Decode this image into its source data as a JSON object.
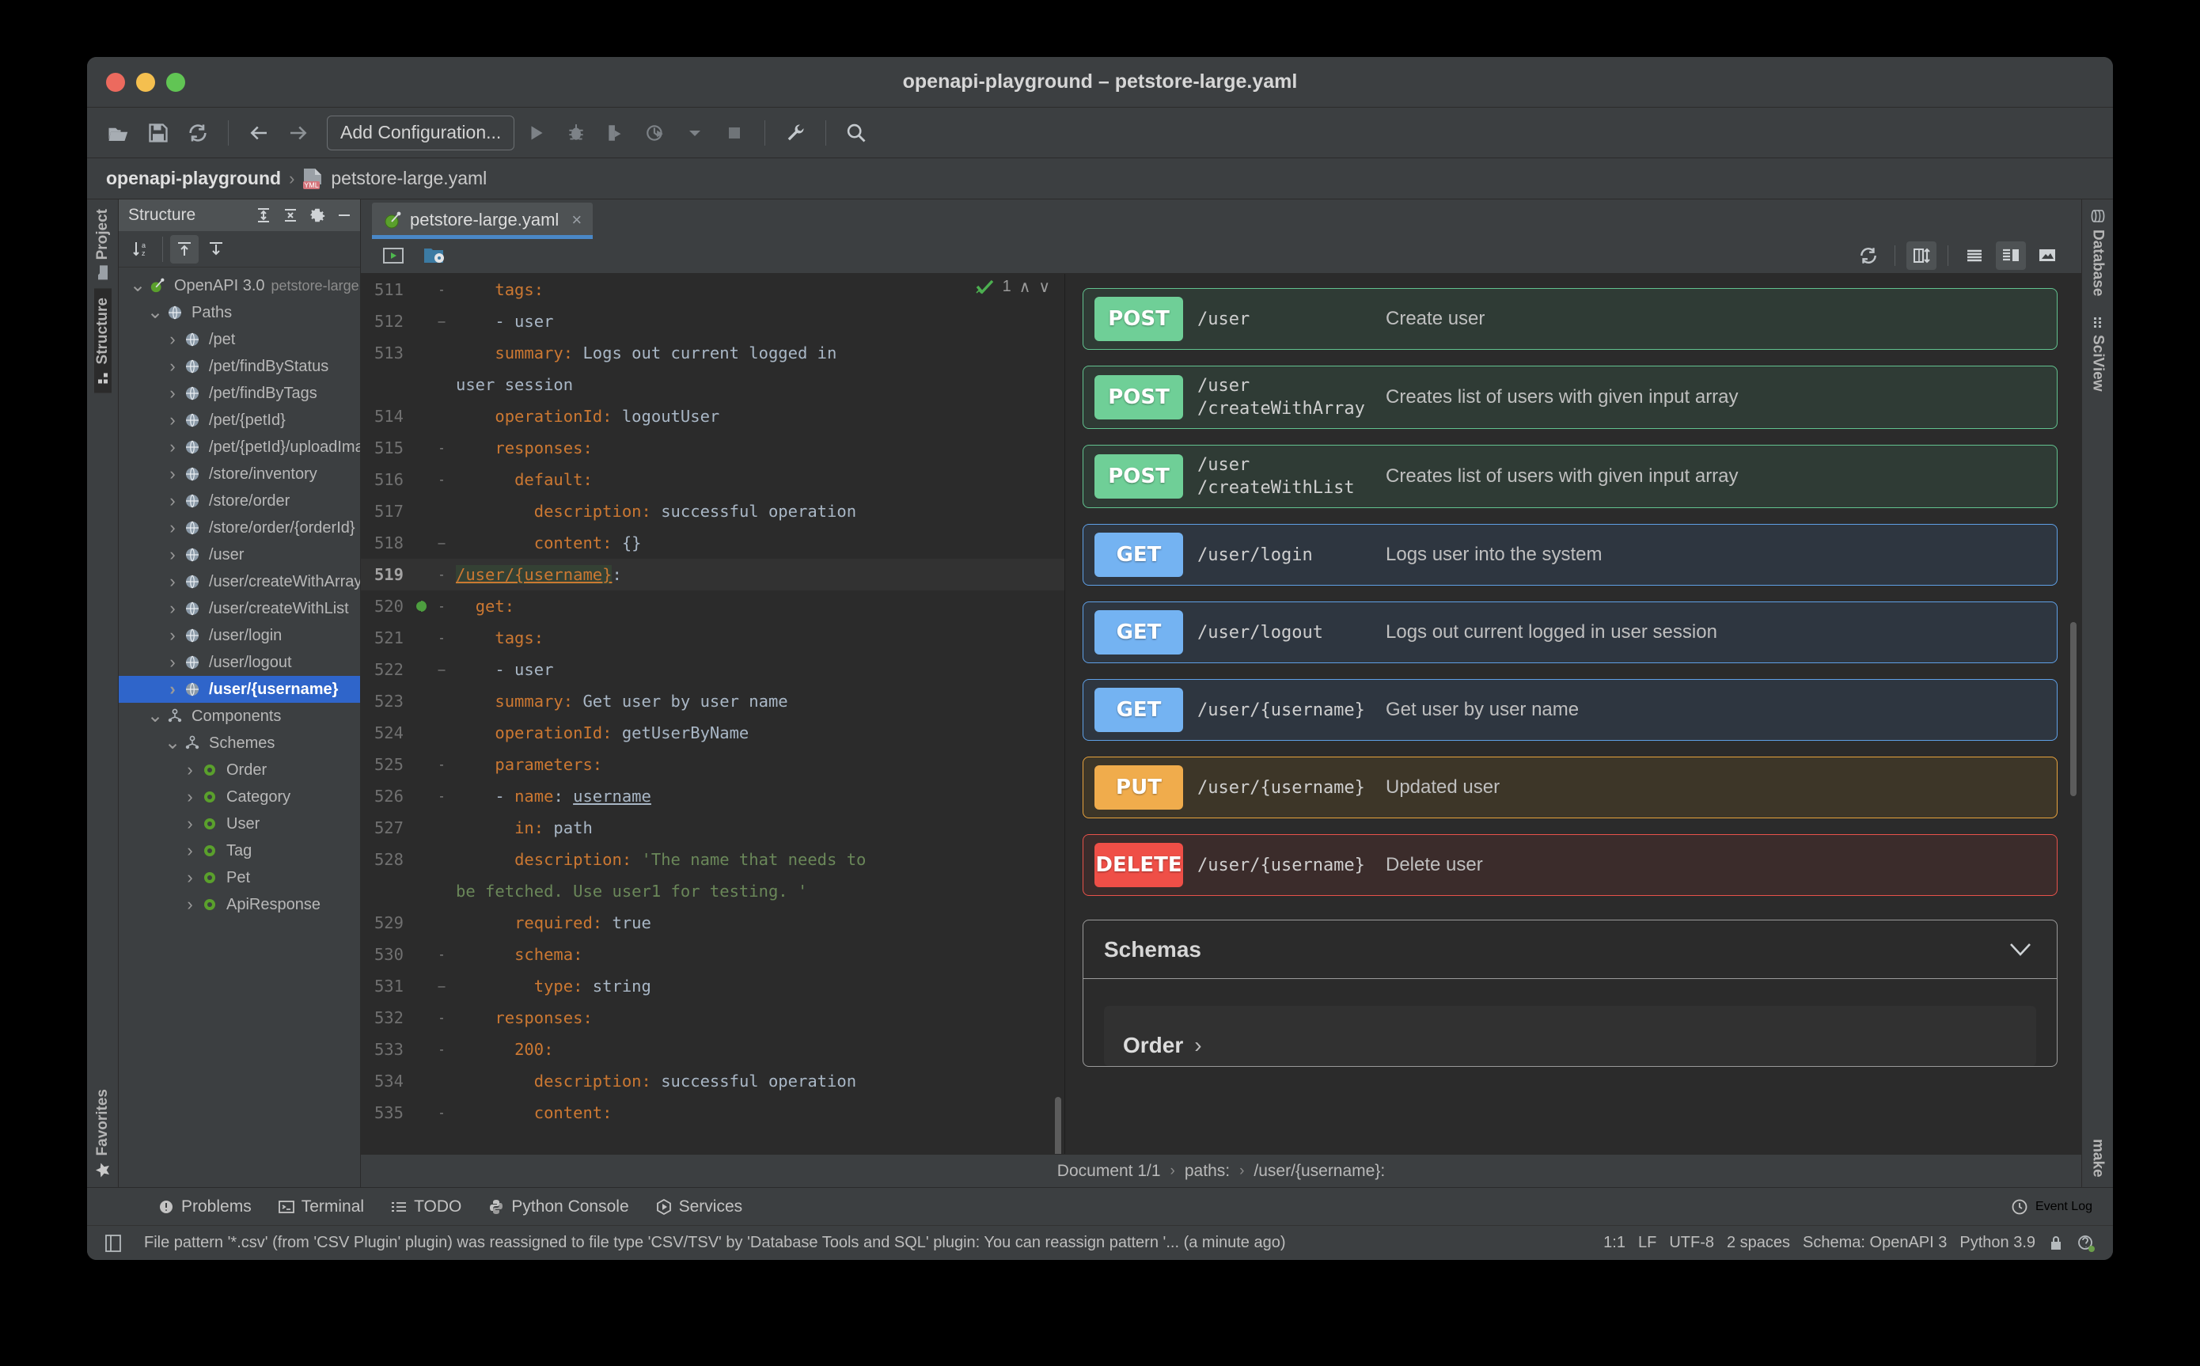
{
  "window": {
    "title": "openapi-playground – petstore-large.yaml"
  },
  "toolbar": {
    "open_label": "open-folder-icon",
    "save_label": "save-icon",
    "sync_label": "sync-icon",
    "back_label": "back-arrow-icon",
    "forward_label": "forward-arrow-icon",
    "run_config": "Add Configuration...",
    "run_label": "run-icon",
    "debug_label": "debug-icon",
    "coverage_label": "run-with-coverage-icon",
    "profile_label": "profile-icon",
    "stop_label": "stop-icon",
    "settings_label": "wrench-icon",
    "search_label": "search-icon"
  },
  "breadcrumb": {
    "project": "openapi-playground",
    "separator": "›",
    "file": "petstore-large.yaml",
    "file_type": "YML"
  },
  "left_strip": {
    "project_tab": "Project",
    "structure_tab": "Structure",
    "favorites_tab": "Favorites"
  },
  "right_strip": {
    "database_tab": "Database",
    "sciview_tab": "SciView",
    "make_tab": "make"
  },
  "structure": {
    "title": "Structure",
    "expandall_label": "expand-all-icon",
    "collapseall_label": "collapse-all-icon",
    "settings_label": "gear-icon",
    "hide_label": "minimize-icon",
    "sort_label": "sort-alphabetically-icon",
    "autoscroll_from_source_label": "autoscroll-from-source-icon",
    "autoscroll_to_source_label": "autoscroll-to-source-icon",
    "tree": [
      {
        "label": "OpenAPI 3.0",
        "sub": "petstore-large.yaml",
        "depth": 0,
        "arrow": "v",
        "icon": "openapi-icon"
      },
      {
        "label": "Paths",
        "depth": 1,
        "arrow": "v",
        "icon": "globe-icon"
      },
      {
        "label": "/pet",
        "depth": 2,
        "arrow": ">",
        "icon": "globe-icon"
      },
      {
        "label": "/pet/findByStatus",
        "depth": 2,
        "arrow": ">",
        "icon": "globe-icon"
      },
      {
        "label": "/pet/findByTags",
        "depth": 2,
        "arrow": ">",
        "icon": "globe-icon"
      },
      {
        "label": "/pet/{petId}",
        "depth": 2,
        "arrow": ">",
        "icon": "globe-icon"
      },
      {
        "label": "/pet/{petId}/uploadImage",
        "depth": 2,
        "arrow": ">",
        "icon": "globe-icon"
      },
      {
        "label": "/store/inventory",
        "depth": 2,
        "arrow": ">",
        "icon": "globe-icon"
      },
      {
        "label": "/store/order",
        "depth": 2,
        "arrow": ">",
        "icon": "globe-icon"
      },
      {
        "label": "/store/order/{orderId}",
        "depth": 2,
        "arrow": ">",
        "icon": "globe-icon"
      },
      {
        "label": "/user",
        "depth": 2,
        "arrow": ">",
        "icon": "globe-icon"
      },
      {
        "label": "/user/createWithArray",
        "depth": 2,
        "arrow": ">",
        "icon": "globe-icon"
      },
      {
        "label": "/user/createWithList",
        "depth": 2,
        "arrow": ">",
        "icon": "globe-icon"
      },
      {
        "label": "/user/login",
        "depth": 2,
        "arrow": ">",
        "icon": "globe-icon"
      },
      {
        "label": "/user/logout",
        "depth": 2,
        "arrow": ">",
        "icon": "globe-icon"
      },
      {
        "label": "/user/{username}",
        "depth": 2,
        "arrow": ">",
        "icon": "globe-icon",
        "selected": true
      },
      {
        "label": "Components",
        "depth": 1,
        "arrow": "v",
        "icon": "components-icon"
      },
      {
        "label": "Schemes",
        "depth": 2,
        "arrow": "v",
        "icon": "components-icon"
      },
      {
        "label": "Order",
        "depth": 3,
        "arrow": ">",
        "icon": "schema-icon"
      },
      {
        "label": "Category",
        "depth": 3,
        "arrow": ">",
        "icon": "schema-icon"
      },
      {
        "label": "User",
        "depth": 3,
        "arrow": ">",
        "icon": "schema-icon"
      },
      {
        "label": "Tag",
        "depth": 3,
        "arrow": ">",
        "icon": "schema-icon"
      },
      {
        "label": "Pet",
        "depth": 3,
        "arrow": ">",
        "icon": "schema-icon"
      },
      {
        "label": "ApiResponse",
        "depth": 3,
        "arrow": ">",
        "icon": "schema-icon"
      }
    ]
  },
  "editor": {
    "tab_label": "petstore-large.yaml",
    "tab_close": "×",
    "preview_run_label": "run-preview-icon",
    "structure_view_label": "openapi-view-icon",
    "inspections": {
      "count": "1",
      "up": "∧",
      "down": "∨"
    },
    "toolbar_right": {
      "reload": "refresh-icon",
      "fit_width": "fit-width-icon",
      "list_view": "list-view-icon",
      "split_view": "split-view-icon",
      "image_view": "image-preview-icon"
    },
    "lines": [
      {
        "n": "511",
        "fold": "-",
        "indent": 2,
        "text": "    tags:",
        "type": "key"
      },
      {
        "n": "512",
        "fold": "–",
        "indent": 2,
        "text": "    - user",
        "type": "item"
      },
      {
        "n": "513",
        "fold": "",
        "indent": 2,
        "text": "    summary: Logs out current logged in",
        "wrap": "user session",
        "type": "kv"
      },
      {
        "n": "514",
        "fold": "",
        "indent": 2,
        "text": "    operationId: logoutUser",
        "type": "kv"
      },
      {
        "n": "515",
        "fold": "-",
        "indent": 2,
        "text": "    responses:",
        "type": "key"
      },
      {
        "n": "516",
        "fold": "-",
        "indent": 3,
        "text": "      default:",
        "type": "key"
      },
      {
        "n": "517",
        "fold": "",
        "indent": 4,
        "text": "        description: successful operation",
        "type": "kv"
      },
      {
        "n": "518",
        "fold": "–",
        "indent": 4,
        "text": "        content: {}",
        "type": "kv"
      },
      {
        "n": "519",
        "fold": "-",
        "indent": 0,
        "text": "/user/{username}:",
        "type": "anchor",
        "current": true
      },
      {
        "n": "520",
        "fold": "-",
        "indent": 1,
        "text": "  get:",
        "type": "key",
        "gutter": "endpoint-icon"
      },
      {
        "n": "521",
        "fold": "-",
        "indent": 2,
        "text": "    tags:",
        "type": "key"
      },
      {
        "n": "522",
        "fold": "–",
        "indent": 2,
        "text": "    - user",
        "type": "item"
      },
      {
        "n": "523",
        "fold": "",
        "indent": 2,
        "text": "    summary: Get user by user name",
        "type": "kv"
      },
      {
        "n": "524",
        "fold": "",
        "indent": 2,
        "text": "    operationId: getUserByName",
        "type": "kv"
      },
      {
        "n": "525",
        "fold": "-",
        "indent": 2,
        "text": "    parameters:",
        "type": "key"
      },
      {
        "n": "526",
        "fold": "-",
        "indent": 2,
        "text": "    - name: username",
        "type": "param"
      },
      {
        "n": "527",
        "fold": "",
        "indent": 3,
        "text": "      in: path",
        "type": "kv"
      },
      {
        "n": "528",
        "fold": "",
        "indent": 3,
        "text": "      description: 'The name that needs to",
        "wrap": "be fetched. Use user1 for testing. '",
        "type": "str"
      },
      {
        "n": "529",
        "fold": "",
        "indent": 3,
        "text": "      required: true",
        "type": "kv"
      },
      {
        "n": "530",
        "fold": "-",
        "indent": 3,
        "text": "      schema:",
        "type": "key"
      },
      {
        "n": "531",
        "fold": "–",
        "indent": 4,
        "text": "        type: string",
        "type": "kv"
      },
      {
        "n": "532",
        "fold": "-",
        "indent": 2,
        "text": "    responses:",
        "type": "key"
      },
      {
        "n": "533",
        "fold": "-",
        "indent": 3,
        "text": "      200:",
        "type": "key"
      },
      {
        "n": "534",
        "fold": "",
        "indent": 4,
        "text": "        description: successful operation",
        "type": "kv"
      },
      {
        "n": "535",
        "fold": "-",
        "indent": 4,
        "text": "        content:",
        "type": "key"
      }
    ]
  },
  "preview": {
    "endpoints": [
      {
        "method": "POST",
        "path": "/user",
        "summary": "Create user",
        "style": "post"
      },
      {
        "method": "POST",
        "path": "/user\n/createWithArray",
        "summary": "Creates list of users with given input array",
        "style": "post"
      },
      {
        "method": "POST",
        "path": "/user\n/createWithList",
        "summary": "Creates list of users with given input array",
        "style": "post"
      },
      {
        "method": "GET",
        "path": "/user/login",
        "summary": "Logs user into the system",
        "style": "get"
      },
      {
        "method": "GET",
        "path": "/user/logout",
        "summary": "Logs out current logged in user session",
        "style": "get"
      },
      {
        "method": "GET",
        "path": "/user/{username}",
        "summary": "Get user by user name",
        "style": "get"
      },
      {
        "method": "PUT",
        "path": "/user/{username}",
        "summary": "Updated user",
        "style": "put"
      },
      {
        "method": "DELETE",
        "path": "/user/{username}",
        "summary": "Delete user",
        "style": "delete"
      }
    ],
    "schemas": {
      "title": "Schemas",
      "collapse_icon": "chevron-down-icon",
      "first_item": "Order",
      "first_item_chevron": "›"
    }
  },
  "doc_bar": {
    "document": "Document 1/1",
    "sep": "›",
    "paths": "paths:",
    "current": "/user/{username}:"
  },
  "bottom_tabs": [
    {
      "label": "Problems",
      "icon": "problems-icon"
    },
    {
      "label": "Terminal",
      "icon": "terminal-icon"
    },
    {
      "label": "TODO",
      "icon": "todo-icon"
    },
    {
      "label": "Python Console",
      "icon": "python-icon"
    },
    {
      "label": "Services",
      "icon": "services-icon"
    }
  ],
  "event_log": {
    "label": "Event Log",
    "icon": "event-log-icon"
  },
  "statusbar": {
    "message": "File pattern '*.csv' (from 'CSV Plugin' plugin) was reassigned to file type 'CSV/TSV' by 'Database Tools and SQL' plugin: You can reassign pattern '... (a minute ago)",
    "caret": "1:1",
    "line_sep": "LF",
    "encoding": "UTF-8",
    "indent": "2 spaces",
    "schema": "Schema: OpenAPI 3",
    "interpreter": "Python 3.9",
    "lock_icon": "lock-icon",
    "inspections_icon": "inspection-level-icon"
  }
}
